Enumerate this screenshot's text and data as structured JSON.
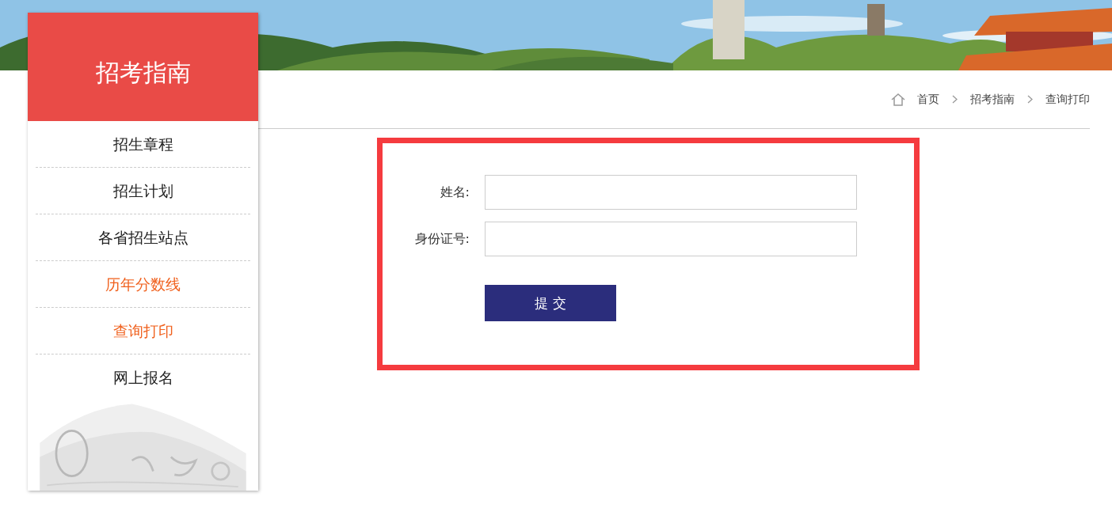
{
  "sidebar": {
    "title": "招考指南",
    "items": [
      {
        "label": "招生章程",
        "selected": false
      },
      {
        "label": "招生计划",
        "selected": false
      },
      {
        "label": "各省招生站点",
        "selected": false
      },
      {
        "label": "历年分数线",
        "selected": true
      },
      {
        "label": "查询打印",
        "selected": true
      },
      {
        "label": "网上报名",
        "selected": false
      }
    ]
  },
  "breadcrumb": [
    "首页",
    "招考指南",
    "查询打印"
  ],
  "form": {
    "fields": [
      {
        "label": "姓名:"
      },
      {
        "label": "身份证号:"
      }
    ],
    "submit": "提 交"
  }
}
